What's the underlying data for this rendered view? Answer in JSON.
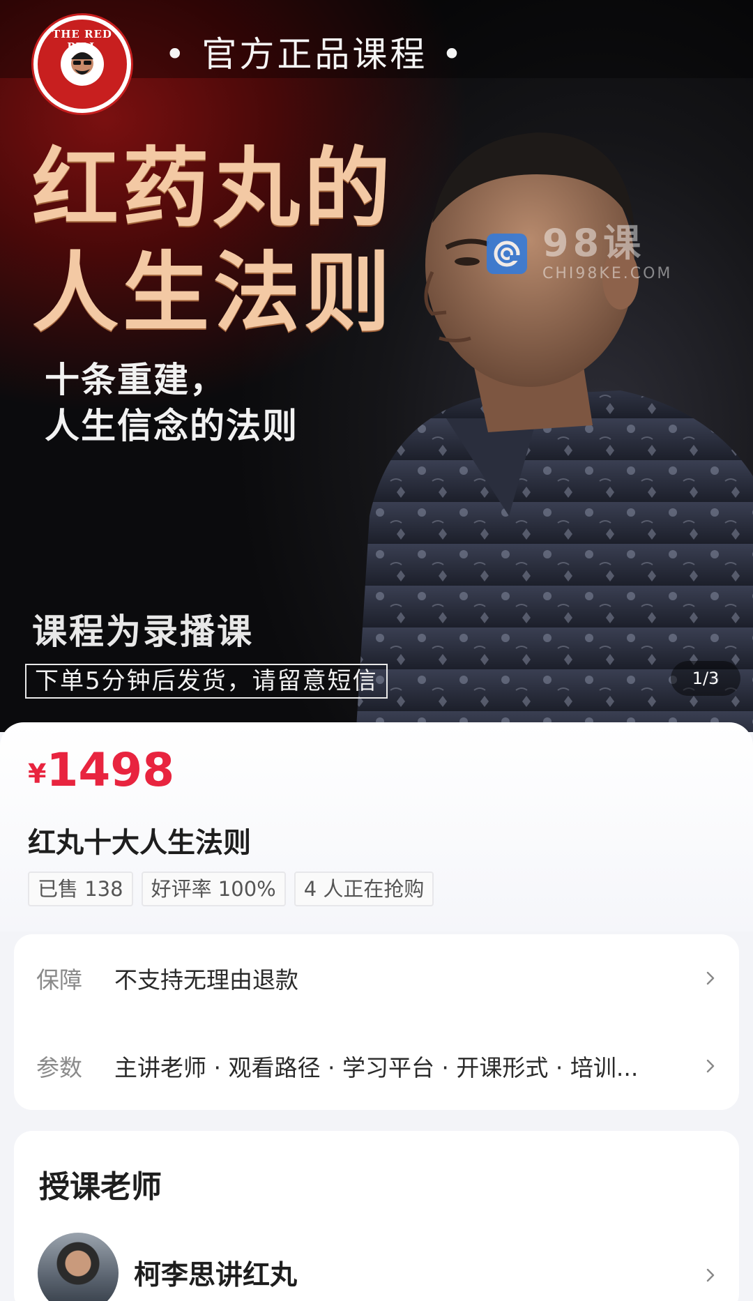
{
  "banner": {
    "logo_text": "THE RED PILL",
    "official_label": "• 官方正品课程 •",
    "title_line1": "红药丸的",
    "title_line2": "人生法则",
    "subtitle_line1": "十条重建，",
    "subtitle_line2": "人生信念的法则",
    "recorded_label": "课程为录播课",
    "notice": "下单5分钟后发货，请留意短信",
    "page_indicator": "1/3",
    "watermark_main": "98课",
    "watermark_sub": "CHI98KE.COM"
  },
  "product": {
    "currency": "¥",
    "price": "1498",
    "title": "红丸十大人生法则",
    "tags": [
      "已售 138",
      "好评率 100%",
      "4 人正在抢购"
    ]
  },
  "details": {
    "guarantee_label": "保障",
    "guarantee_value": "不支持无理由退款",
    "params_label": "参数",
    "params_value": "主讲老师 · 观看路径 · 学习平台 · 开课形式 · 培训..."
  },
  "teacher": {
    "heading": "授课老师",
    "name": "柯李思讲红丸"
  },
  "colors": {
    "price": "#e8243f",
    "accent_title": "#f3c9a4",
    "logo_red": "#c81f1f",
    "watermark_blue": "#2f7be0"
  },
  "icons": [
    "logo-badge-icon",
    "watermark-icon",
    "chevron-right-icon"
  ]
}
